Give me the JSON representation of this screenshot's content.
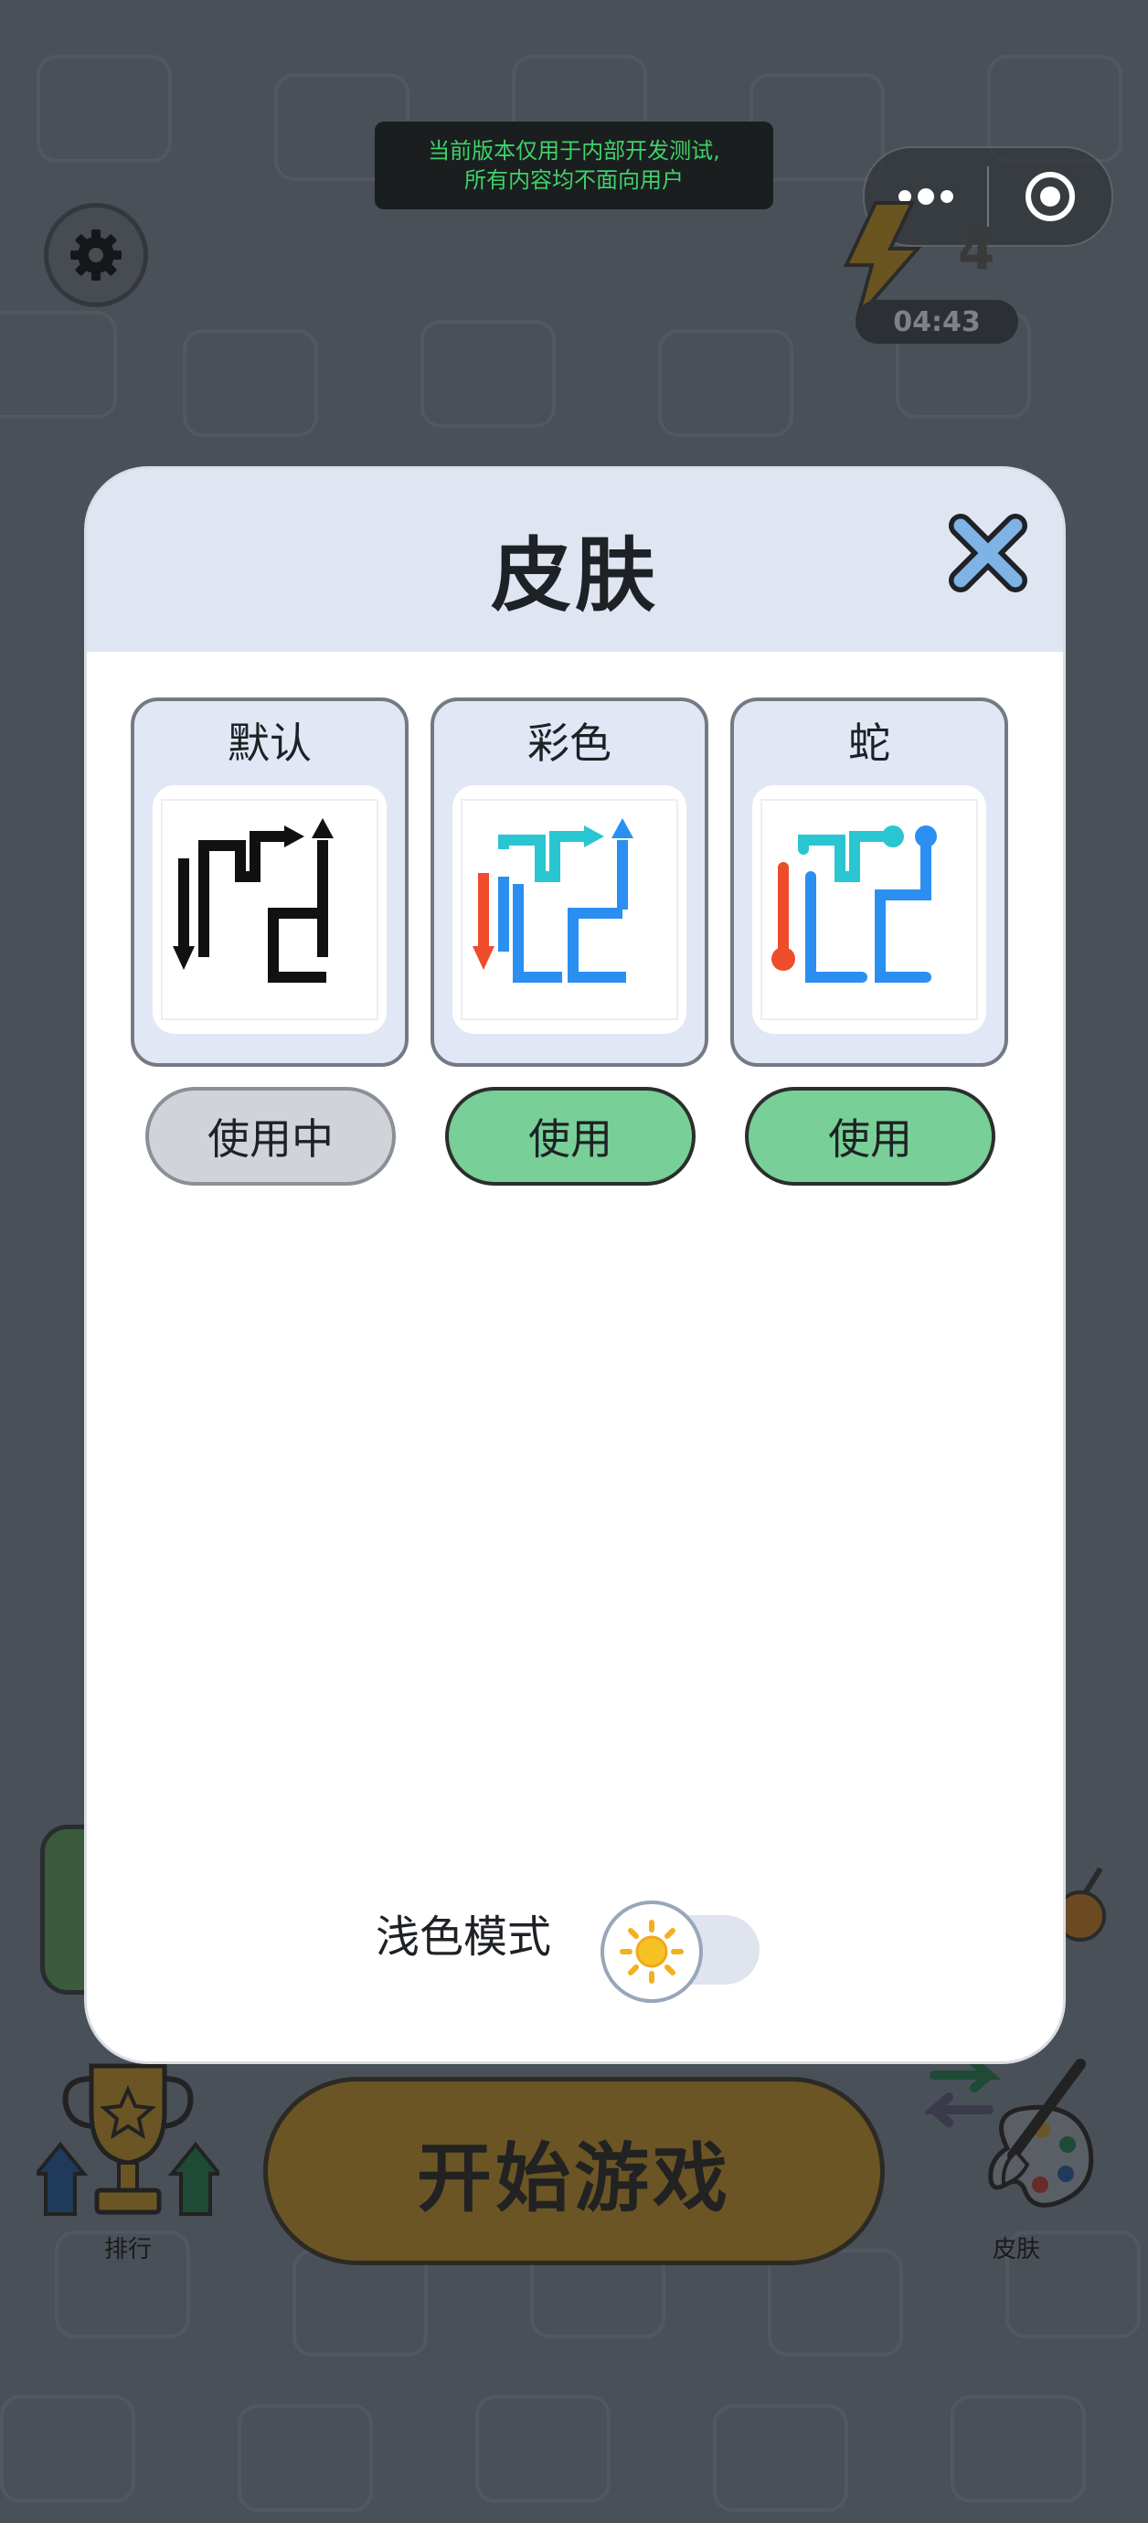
{
  "dev_notice": {
    "line1": "当前版本仅用于内部开发测试,",
    "line2": "所有内容均不面向用户"
  },
  "energy": {
    "count": "4",
    "timer": "04:43"
  },
  "modal": {
    "title": "皮肤",
    "skins": [
      {
        "name": "默认",
        "button": "使用中",
        "state": "in-use"
      },
      {
        "name": "彩色",
        "button": "使用",
        "state": "available"
      },
      {
        "name": "蛇",
        "button": "使用",
        "state": "available"
      }
    ],
    "mode_label": "浅色模式",
    "mode_on": false
  },
  "bottom_bar": {
    "rank_label": "排行",
    "start_label": "开始游戏",
    "skin_label": "皮肤"
  },
  "colors": {
    "accent_green": "#78cf97",
    "arrow_cyan": "#29c6d2",
    "arrow_blue": "#2a8ff0",
    "arrow_red": "#ef4c2c",
    "dev_text": "#3fd16a"
  }
}
